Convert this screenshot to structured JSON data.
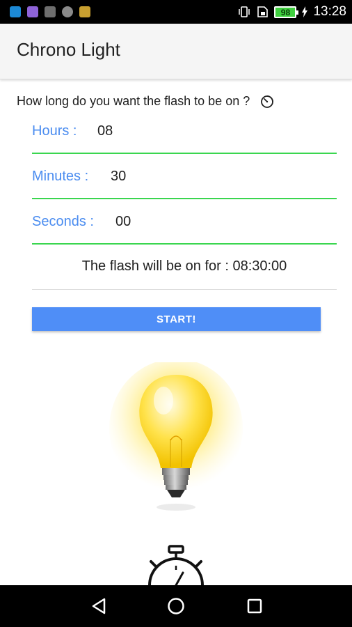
{
  "status_bar": {
    "time": "13:28",
    "battery": "98",
    "notification_icons": [
      "shazam-icon",
      "purple-app-icon",
      "gallery-icon",
      "c-app-icon",
      "gold-app-icon"
    ]
  },
  "app_bar": {
    "title": "Chrono Light"
  },
  "question": {
    "text": "How long do you want the flash to be on ?",
    "icon": "timer-icon"
  },
  "fields": {
    "hours": {
      "label": "Hours :",
      "value": "08"
    },
    "minutes": {
      "label": "Minutes :",
      "value": "30"
    },
    "seconds": {
      "label": "Seconds :",
      "value": "00"
    }
  },
  "summary": "The flash will be on for : 08:30:00",
  "start_button": {
    "label": "START!"
  },
  "colors": {
    "accent_blue": "#4f8ef7",
    "label_blue": "#4a8cf0",
    "underline_green": "#3ad64f",
    "bulb_yellow": "#ffe24a"
  },
  "nav_bar": {
    "icons": [
      "back-icon",
      "home-icon",
      "recents-icon"
    ]
  }
}
